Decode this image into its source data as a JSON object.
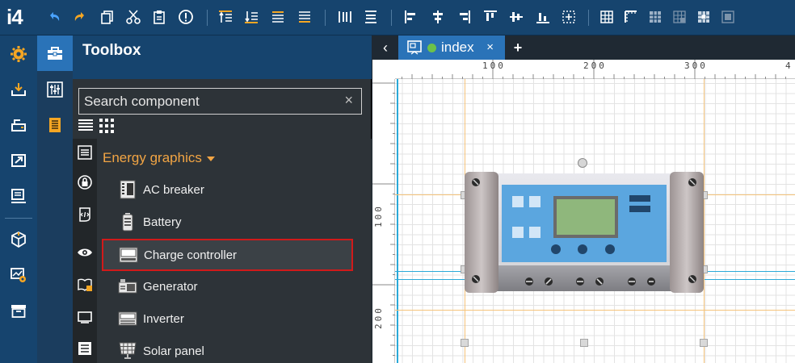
{
  "app": {
    "logo": "i4"
  },
  "toolbox": {
    "title": "Toolbox",
    "search_placeholder": "Search component",
    "search_value": "",
    "clear_label": "×",
    "category": {
      "label": "Energy graphics",
      "items": [
        {
          "label": "AC breaker",
          "icon": "ac-breaker-icon"
        },
        {
          "label": "Battery",
          "icon": "battery-icon"
        },
        {
          "label": "Charge controller",
          "icon": "charge-controller-icon",
          "selected": true
        },
        {
          "label": "Generator",
          "icon": "generator-icon"
        },
        {
          "label": "Inverter",
          "icon": "inverter-icon"
        },
        {
          "label": "Solar panel",
          "icon": "solar-panel-icon"
        }
      ]
    }
  },
  "editor": {
    "tab_label": "index",
    "tab_close": "×",
    "tab_add": "+",
    "back_label": "‹",
    "ruler_top": [
      "100",
      "200",
      "300",
      "4"
    ],
    "ruler_left": [
      "100",
      "200"
    ]
  },
  "colors": {
    "toolbar_bg": "#16446e",
    "accent": "#2a73b8",
    "category_text": "#f2a544",
    "selected_border": "#d11a1a",
    "tab_status": "#6cc24a",
    "guide": "#2aa9d8"
  }
}
